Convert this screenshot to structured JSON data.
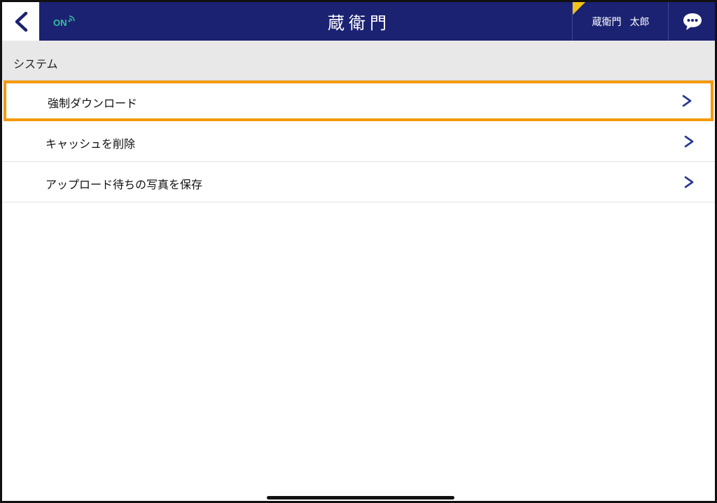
{
  "header": {
    "back_icon": "chevron-left-icon",
    "status_label": "ON",
    "status_icon": "signal-icon",
    "logo_text": "蔵衛門",
    "user_name_family": "蔵衛門",
    "user_name_given": "太郎",
    "chat_icon": "chat-bubble-icon"
  },
  "colors": {
    "header_bg": "#1b2272",
    "accent_selected": "#f39a00",
    "status_on": "#34c29a",
    "chevron": "#283593",
    "user_corner": "#f2c21b"
  },
  "section": {
    "title": "システム"
  },
  "items": [
    {
      "label": "強制ダウンロード",
      "selected": true
    },
    {
      "label": "キャッシュを削除",
      "selected": false
    },
    {
      "label": "アップロード待ちの写真を保存",
      "selected": false
    }
  ]
}
